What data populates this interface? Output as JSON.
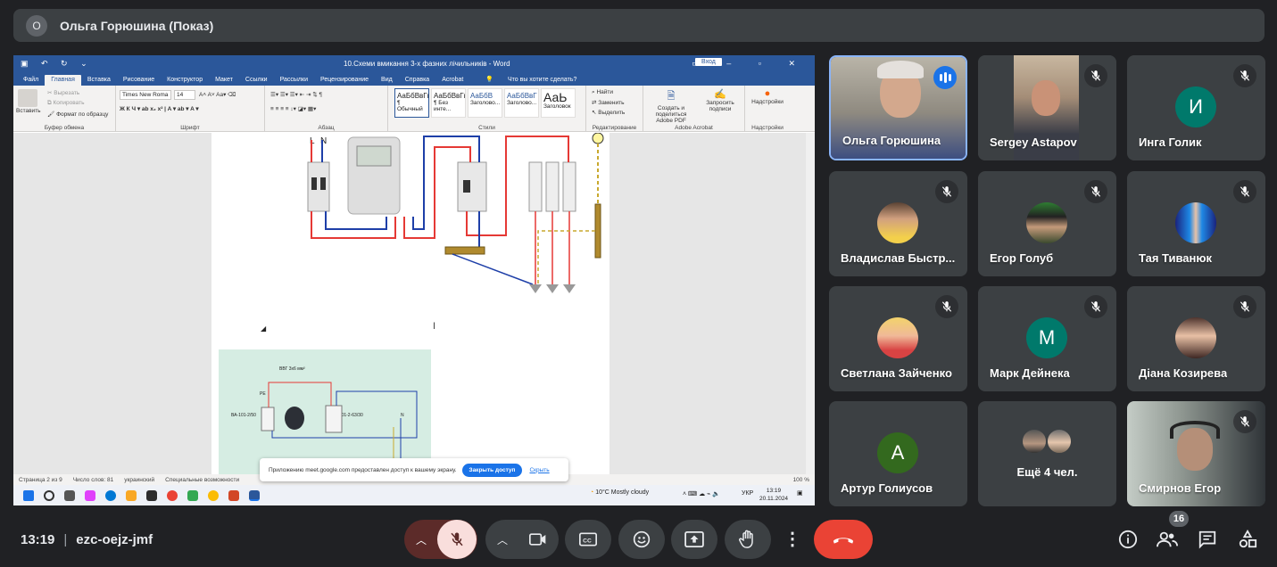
{
  "presenter": {
    "initial": "О",
    "label": "Ольга Горюшина (Показ)"
  },
  "word": {
    "document_title": "10.Схеми вмикання 3-х фазних лічильників  -  Word",
    "signin": "Вход",
    "tabs": [
      "Файл",
      "Главная",
      "Вставка",
      "Рисование",
      "Конструктор",
      "Макет",
      "Ссылки",
      "Рассылки",
      "Рецензирование",
      "Вид",
      "Справка",
      "Acrobat"
    ],
    "tell_me": "Что вы хотите сделать?",
    "clipboard": {
      "paste": "Вставить",
      "cut": "Вырезать",
      "copy": "Копировать",
      "format_painter": "Формат по образцу",
      "label": "Буфер обмена"
    },
    "font": {
      "name": "Times New Roma",
      "size": "14",
      "label": "Шрифт"
    },
    "paragraph_label": "Абзац",
    "styles": [
      {
        "preview": "АаБбВвГг,",
        "name": "¶ Обычный"
      },
      {
        "preview": "АаБбВвГг,",
        "name": "¶ Без инте..."
      },
      {
        "preview": "АаБбВ",
        "name": "Заголово..."
      },
      {
        "preview": "АаБбВвГ",
        "name": "Заголово..."
      },
      {
        "preview": "АаЬ",
        "name": "Заголовок"
      }
    ],
    "styles_label": "Стили",
    "editing": {
      "find": "Найти",
      "replace": "Заменить",
      "select": "Выделить",
      "label": "Редактирование"
    },
    "acrobat": {
      "create": "Создать и поделиться Adobe PDF",
      "request": "Запросить подписи",
      "label": "Adobe Acrobat"
    },
    "addins": {
      "name": "Надстройки",
      "label": "Надстройки"
    },
    "diagram_labels": {
      "l": "L",
      "n": "N",
      "pe": "PE",
      "cable": "ВВГ 3х6 мм²",
      "breaker": "ВА-101-2/50",
      "rcd": "УЗО-01-2-63/30",
      "nn": "N"
    },
    "status": {
      "page": "Страница 2 из 9",
      "words": "Число слов: 81",
      "lang": "украинский",
      "accessibility": "Специальные возможности",
      "zoom": "100 %"
    },
    "share_toast": {
      "text": "Приложению meet.google.com предоставлен доступ к вашему экрану.",
      "stop": "Закрыть доступ",
      "hide": "Скрыть"
    },
    "taskbar": {
      "weather": "10°C  Mostly cloudy",
      "lang": "УКР",
      "time": "13:19",
      "date": "20.11.2024"
    }
  },
  "participants": [
    {
      "name": "Ольга Горюшина",
      "type": "video",
      "speaking": true
    },
    {
      "name": "Sergey Astapov",
      "type": "video",
      "muted": true
    },
    {
      "name": "Инга Голик",
      "type": "letter",
      "letter": "И",
      "color": "#00796b",
      "muted": true
    },
    {
      "name": "Владислав Быстр...",
      "type": "photo",
      "muted": true
    },
    {
      "name": "Егор Голуб",
      "type": "photo",
      "muted": true
    },
    {
      "name": "Тая Тиванюк",
      "type": "photo",
      "muted": true
    },
    {
      "name": "Светлана Зайченко",
      "type": "photo",
      "muted": true
    },
    {
      "name": "Марк Дейнека",
      "type": "letter",
      "letter": "М",
      "color": "#00796b",
      "muted": true
    },
    {
      "name": "Діана Козирева",
      "type": "photo",
      "muted": true
    },
    {
      "name": "Артур Голиусов",
      "type": "letter",
      "letter": "А",
      "color": "#33691e",
      "muted": false
    },
    {
      "name": "Ещё 4 чел.",
      "type": "more"
    },
    {
      "name": "Смирнов Егор",
      "type": "video",
      "muted": true
    }
  ],
  "bottom": {
    "time": "13:19",
    "meeting_code": "ezc-oejz-jmf",
    "people_count": "16"
  },
  "colors": {
    "accent": "#8ab4f8",
    "end_call": "#ea4335",
    "speaking": "#1a73e8",
    "word_blue": "#2b579a"
  }
}
